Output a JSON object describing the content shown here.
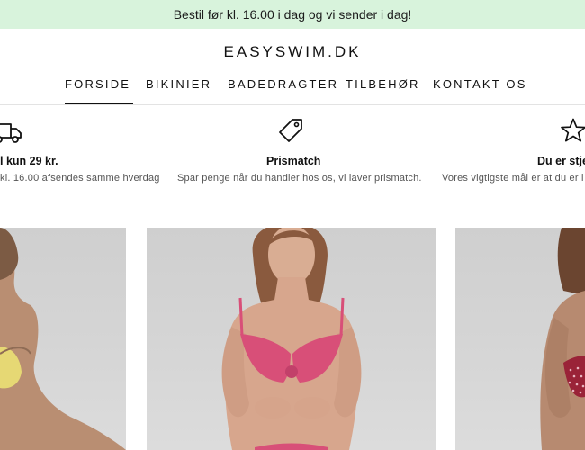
{
  "announcement": {
    "text": "Bestil før kl. 16.00 i dag og vi sender i dag!"
  },
  "header": {
    "logo": "EASYSWIM.DK"
  },
  "nav": {
    "items": [
      {
        "label": "FORSIDE",
        "active": true
      },
      {
        "label": "BIKINIER"
      },
      {
        "label": "BADEDRAGTER"
      },
      {
        "label": "TILBEHØR"
      },
      {
        "label": "KONTAKT OS"
      }
    ]
  },
  "usps": [
    {
      "icon": "truck-icon",
      "title": "l kun 29 kr.",
      "text": "kl. 16.00 afsendes samme hverdag"
    },
    {
      "icon": "price-tag-icon",
      "title": "Prismatch",
      "text": "Spar penge når du handler hos os, vi laver prismatch."
    },
    {
      "icon": "star-icon",
      "title": "Du er stjer",
      "text": "Vores vigtigste mål er at du er i fo"
    }
  ],
  "products": [
    {
      "image": "product-image-yellow-bikini",
      "color": "#e8dc7a"
    },
    {
      "image": "product-image-pink-bikini",
      "color": "#d84f78"
    },
    {
      "image": "product-image-polka-bikini",
      "color": "#9a2338"
    }
  ]
}
